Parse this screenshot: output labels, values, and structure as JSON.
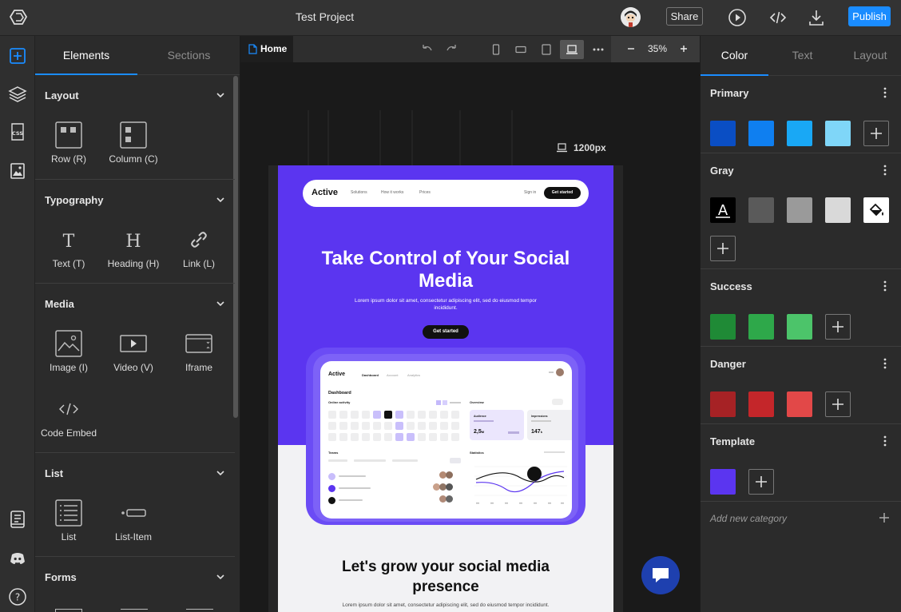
{
  "topbar": {
    "project_title": "Test Project",
    "share_label": "Share",
    "publish_label": "Publish"
  },
  "left_panel": {
    "tabs": [
      "Elements",
      "Sections"
    ],
    "sections": [
      {
        "title": "Layout",
        "items": [
          "Row (R)",
          "Column (C)"
        ]
      },
      {
        "title": "Typography",
        "items": [
          "Text (T)",
          "Heading (H)",
          "Link (L)"
        ]
      },
      {
        "title": "Media",
        "items": [
          "Image (I)",
          "Video (V)",
          "Iframe",
          "Code Embed"
        ]
      },
      {
        "title": "List",
        "items": [
          "List",
          "List-Item"
        ]
      },
      {
        "title": "Forms",
        "items": []
      }
    ]
  },
  "canvas_bar": {
    "page_tab": "Home",
    "zoom": "35%"
  },
  "canvas": {
    "viewport_width_label": "1200px"
  },
  "site": {
    "nav": {
      "brand": "Active",
      "links": [
        "Solutions",
        "How it works",
        "Prices"
      ],
      "signin": "Sign in",
      "cta": "Get started"
    },
    "hero": {
      "title": "Take Control of Your Social Media",
      "subtitle": "Lorem ipsum dolor sit amet, consectetur adipiscing elit, sed do eiusmod tempor incididunt.",
      "cta": "Get started"
    },
    "dashboard": {
      "brand": "Active",
      "tabs": [
        "Dashboard",
        "Account",
        "Analytics"
      ],
      "title": "Dashboard",
      "online_activity": "Online activity",
      "overview": "Overview",
      "audience_label": "Audience",
      "audience_value": "2,5",
      "audience_unit": "M",
      "impressions_label": "Impressions",
      "impressions_value": "147",
      "impressions_unit": "k",
      "teams": "Teams",
      "statistics": "Statistics"
    },
    "section2": {
      "title": "Let's grow your social media presence",
      "subtitle": "Lorem ipsum dolor sit amet, consectetur adipiscing elit, sed do eiusmod tempor incididunt."
    }
  },
  "right_panel": {
    "tabs": [
      "Color",
      "Text",
      "Layout"
    ],
    "categories": [
      {
        "name": "Primary",
        "colors": [
          "#0a4ec4",
          "#0f7ff0",
          "#19a8f5",
          "#7fd6f8"
        ]
      },
      {
        "name": "Gray",
        "colors": [
          "#000000",
          "#5a5a5a",
          "#9a9a9a",
          "#d9d9d9",
          "#ffffff"
        ]
      },
      {
        "name": "Success",
        "colors": [
          "#1f8a36",
          "#2ea84a",
          "#4cc46a"
        ]
      },
      {
        "name": "Danger",
        "colors": [
          "#a62225",
          "#c4262a",
          "#e24848"
        ]
      },
      {
        "name": "Template",
        "colors": [
          "#5b35f0"
        ]
      }
    ],
    "add_category": "Add new category"
  },
  "colors": {
    "accent": "#1a8cff",
    "hero": "#5b35f0",
    "chat": "#1e40af"
  }
}
